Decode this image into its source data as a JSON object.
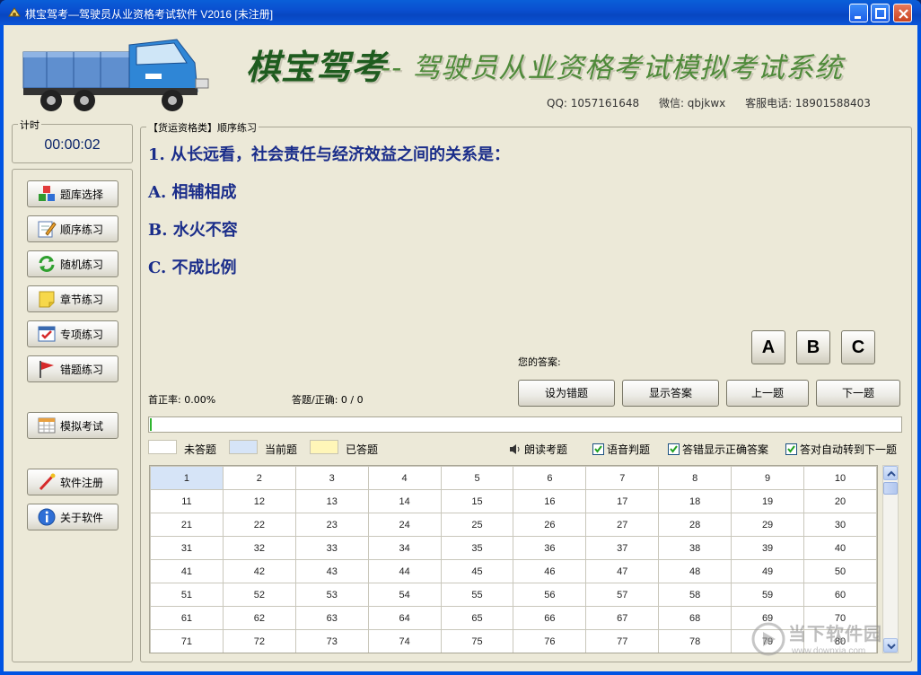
{
  "window": {
    "title": "棋宝驾考—驾驶员从业资格考试软件 V2016 [未注册]"
  },
  "header": {
    "brand": "棋宝驾考",
    "slogan": "-- 驾驶员从业资格考试模拟考试系统",
    "qq": "QQ: 1057161648",
    "wechat": "微信: qbjkwx",
    "phone": "客服电话: 18901588403"
  },
  "timer": {
    "label": "计时",
    "value": "00:00:02"
  },
  "sidebar": {
    "items": [
      {
        "label": "题库选择",
        "icon": "cubes-icon"
      },
      {
        "label": "顺序练习",
        "icon": "pencil-note-icon"
      },
      {
        "label": "随机练习",
        "icon": "refresh-arrows-icon"
      },
      {
        "label": "章节练习",
        "icon": "sticky-note-icon"
      },
      {
        "label": "专项练习",
        "icon": "checklist-icon"
      },
      {
        "label": "错题练习",
        "icon": "red-flag-icon"
      },
      {
        "label": "模拟考试",
        "icon": "calendar-icon"
      },
      {
        "label": "软件注册",
        "icon": "wand-icon"
      },
      {
        "label": "关于软件",
        "icon": "info-icon"
      }
    ]
  },
  "main": {
    "group_label": "【货运资格类】顺序练习",
    "question": "1. 从长远看，社会责任与经济效益之间的关系是：",
    "options": [
      "A. 相辅相成",
      "B. 水火不容",
      "C. 不成比例"
    ],
    "your_answer_label": "您的答案:",
    "answer_buttons": [
      "A",
      "B",
      "C"
    ],
    "first_correct_rate": "首正率: 0.00%",
    "answered_correct": "答题/正确: 0 / 0",
    "actions": {
      "mark_wrong": "设为错题",
      "show_answer": "显示答案",
      "prev": "上一题",
      "next": "下一题"
    },
    "progress": 0.0,
    "legend": {
      "unanswered": "未答题",
      "current": "当前题",
      "answered": "已答题"
    },
    "options_bar": {
      "read_aloud": "朗读考题",
      "voice_judge": "语音判题",
      "show_correct_on_wrong": "答错显示正确答案",
      "auto_next_on_correct": "答对自动转到下一题"
    },
    "grid_rows": [
      [
        "1",
        "2",
        "3",
        "4",
        "5",
        "6",
        "7",
        "8",
        "9",
        "10"
      ],
      [
        "11",
        "12",
        "13",
        "14",
        "15",
        "16",
        "17",
        "18",
        "19",
        "20"
      ],
      [
        "21",
        "22",
        "23",
        "24",
        "25",
        "26",
        "27",
        "28",
        "29",
        "30"
      ],
      [
        "31",
        "32",
        "33",
        "34",
        "35",
        "36",
        "37",
        "38",
        "39",
        "40"
      ],
      [
        "41",
        "42",
        "43",
        "44",
        "45",
        "46",
        "47",
        "48",
        "49",
        "50"
      ],
      [
        "51",
        "52",
        "53",
        "54",
        "55",
        "56",
        "57",
        "58",
        "59",
        "60"
      ],
      [
        "61",
        "62",
        "63",
        "64",
        "65",
        "66",
        "67",
        "68",
        "69",
        "70"
      ],
      [
        "71",
        "72",
        "73",
        "74",
        "75",
        "76",
        "77",
        "78",
        "79",
        "80"
      ]
    ]
  },
  "watermark": {
    "main": "当下软件园",
    "sub": "www.downxia.com"
  },
  "colors": {
    "current_cell": "#d6e4f7",
    "answered_swatch": "#fff6b8",
    "question_text": "#1a2d8a"
  }
}
